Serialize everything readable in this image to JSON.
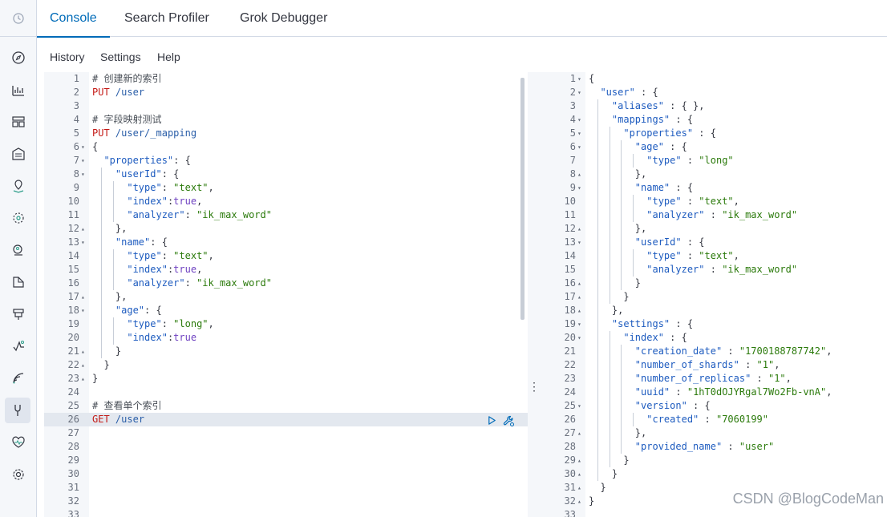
{
  "tabs": [
    {
      "label": "Console",
      "active": true
    },
    {
      "label": "Search Profiler",
      "active": false
    },
    {
      "label": "Grok Debugger",
      "active": false
    }
  ],
  "menu": {
    "history": "History",
    "settings": "Settings",
    "help": "Help"
  },
  "sidenav": [
    {
      "icon": "clock-icon"
    },
    {
      "icon": "compass-icon"
    },
    {
      "icon": "chart-icon"
    },
    {
      "icon": "dashboard-icon"
    },
    {
      "icon": "canvas-icon"
    },
    {
      "icon": "maps-icon"
    },
    {
      "icon": "ml-icon"
    },
    {
      "icon": "graph-icon"
    },
    {
      "icon": "logs-icon"
    },
    {
      "icon": "apm-icon"
    },
    {
      "icon": "uptime-icon"
    },
    {
      "icon": "signal-icon"
    },
    {
      "icon": "devtools-icon",
      "active": true
    },
    {
      "icon": "heart-monitor-icon"
    },
    {
      "icon": "gear-icon"
    }
  ],
  "request_lines": [
    {
      "n": "1",
      "fold": "",
      "code": "# 创建新的索引",
      "type": "comment"
    },
    {
      "n": "2",
      "fold": "",
      "code": "PUT /user",
      "type": "request"
    },
    {
      "n": "3",
      "fold": "",
      "code": "",
      "type": "plain"
    },
    {
      "n": "4",
      "fold": "",
      "code": "# 字段映射测试",
      "type": "comment"
    },
    {
      "n": "5",
      "fold": "",
      "code": "PUT /user/_mapping",
      "type": "request"
    },
    {
      "n": "6",
      "fold": "▾",
      "code": "{",
      "type": "plain"
    },
    {
      "n": "7",
      "fold": "▾",
      "code": "  \"properties\": {",
      "type": "json"
    },
    {
      "n": "8",
      "fold": "▾",
      "code": "    \"userId\": {",
      "type": "json"
    },
    {
      "n": "9",
      "fold": "",
      "code": "      \"type\": \"text\",",
      "type": "json"
    },
    {
      "n": "10",
      "fold": "",
      "code": "      \"index\":true,",
      "type": "json"
    },
    {
      "n": "11",
      "fold": "",
      "code": "      \"analyzer\": \"ik_max_word\"",
      "type": "json"
    },
    {
      "n": "12",
      "fold": "▴",
      "code": "    },",
      "type": "json"
    },
    {
      "n": "13",
      "fold": "▾",
      "code": "    \"name\": {",
      "type": "json"
    },
    {
      "n": "14",
      "fold": "",
      "code": "      \"type\": \"text\",",
      "type": "json"
    },
    {
      "n": "15",
      "fold": "",
      "code": "      \"index\":true,",
      "type": "json"
    },
    {
      "n": "16",
      "fold": "",
      "code": "      \"analyzer\": \"ik_max_word\"",
      "type": "json"
    },
    {
      "n": "17",
      "fold": "▴",
      "code": "    },",
      "type": "json"
    },
    {
      "n": "18",
      "fold": "▾",
      "code": "    \"age\": {",
      "type": "json"
    },
    {
      "n": "19",
      "fold": "",
      "code": "      \"type\": \"long\",",
      "type": "json"
    },
    {
      "n": "20",
      "fold": "",
      "code": "      \"index\":true",
      "type": "json"
    },
    {
      "n": "21",
      "fold": "▴",
      "code": "    }",
      "type": "json"
    },
    {
      "n": "22",
      "fold": "▴",
      "code": "  }",
      "type": "json"
    },
    {
      "n": "23",
      "fold": "▴",
      "code": "}",
      "type": "plain"
    },
    {
      "n": "24",
      "fold": "",
      "code": "",
      "type": "plain"
    },
    {
      "n": "25",
      "fold": "",
      "code": "# 查看单个索引",
      "type": "comment"
    },
    {
      "n": "26",
      "fold": "",
      "code": "GET /user",
      "type": "request",
      "active": true
    },
    {
      "n": "27",
      "fold": "",
      "code": "",
      "type": "plain"
    },
    {
      "n": "28",
      "fold": "",
      "code": "",
      "type": "plain"
    },
    {
      "n": "29",
      "fold": "",
      "code": "",
      "type": "plain"
    },
    {
      "n": "30",
      "fold": "",
      "code": "",
      "type": "plain"
    },
    {
      "n": "31",
      "fold": "",
      "code": "",
      "type": "plain"
    },
    {
      "n": "32",
      "fold": "",
      "code": "",
      "type": "plain"
    },
    {
      "n": "33",
      "fold": "",
      "code": "",
      "type": "plain"
    }
  ],
  "response_lines": [
    {
      "n": "1",
      "fold": "▾",
      "code": "{",
      "type": "plain"
    },
    {
      "n": "2",
      "fold": "▾",
      "code": "  \"user\" : {",
      "type": "json"
    },
    {
      "n": "3",
      "fold": "",
      "code": "    \"aliases\" : { },",
      "type": "json"
    },
    {
      "n": "4",
      "fold": "▾",
      "code": "    \"mappings\" : {",
      "type": "json"
    },
    {
      "n": "5",
      "fold": "▾",
      "code": "      \"properties\" : {",
      "type": "json"
    },
    {
      "n": "6",
      "fold": "▾",
      "code": "        \"age\" : {",
      "type": "json"
    },
    {
      "n": "7",
      "fold": "",
      "code": "          \"type\" : \"long\"",
      "type": "json"
    },
    {
      "n": "8",
      "fold": "▴",
      "code": "        },",
      "type": "json"
    },
    {
      "n": "9",
      "fold": "▾",
      "code": "        \"name\" : {",
      "type": "json"
    },
    {
      "n": "10",
      "fold": "",
      "code": "          \"type\" : \"text\",",
      "type": "json"
    },
    {
      "n": "11",
      "fold": "",
      "code": "          \"analyzer\" : \"ik_max_word\"",
      "type": "json"
    },
    {
      "n": "12",
      "fold": "▴",
      "code": "        },",
      "type": "json"
    },
    {
      "n": "13",
      "fold": "▾",
      "code": "        \"userId\" : {",
      "type": "json"
    },
    {
      "n": "14",
      "fold": "",
      "code": "          \"type\" : \"text\",",
      "type": "json"
    },
    {
      "n": "15",
      "fold": "",
      "code": "          \"analyzer\" : \"ik_max_word\"",
      "type": "json"
    },
    {
      "n": "16",
      "fold": "▴",
      "code": "        }",
      "type": "json"
    },
    {
      "n": "17",
      "fold": "▴",
      "code": "      }",
      "type": "json"
    },
    {
      "n": "18",
      "fold": "▴",
      "code": "    },",
      "type": "json"
    },
    {
      "n": "19",
      "fold": "▾",
      "code": "    \"settings\" : {",
      "type": "json"
    },
    {
      "n": "20",
      "fold": "▾",
      "code": "      \"index\" : {",
      "type": "json"
    },
    {
      "n": "21",
      "fold": "",
      "code": "        \"creation_date\" : \"1700188787742\",",
      "type": "json"
    },
    {
      "n": "22",
      "fold": "",
      "code": "        \"number_of_shards\" : \"1\",",
      "type": "json"
    },
    {
      "n": "23",
      "fold": "",
      "code": "        \"number_of_replicas\" : \"1\",",
      "type": "json"
    },
    {
      "n": "24",
      "fold": "",
      "code": "        \"uuid\" : \"1hT0dOJYRgal7Wo2Fb-vnA\",",
      "type": "json"
    },
    {
      "n": "25",
      "fold": "▾",
      "code": "        \"version\" : {",
      "type": "json"
    },
    {
      "n": "26",
      "fold": "",
      "code": "          \"created\" : \"7060199\"",
      "type": "json"
    },
    {
      "n": "27",
      "fold": "▴",
      "code": "        },",
      "type": "json"
    },
    {
      "n": "28",
      "fold": "",
      "code": "        \"provided_name\" : \"user\"",
      "type": "json"
    },
    {
      "n": "29",
      "fold": "▴",
      "code": "      }",
      "type": "json"
    },
    {
      "n": "30",
      "fold": "▴",
      "code": "    }",
      "type": "json"
    },
    {
      "n": "31",
      "fold": "▴",
      "code": "  }",
      "type": "json"
    },
    {
      "n": "32",
      "fold": "▴",
      "code": "}",
      "type": "plain"
    },
    {
      "n": "33",
      "fold": "",
      "code": "",
      "type": "plain"
    }
  ],
  "watermark": "CSDN @BlogCodeMan",
  "colors": {
    "accent": "#006bb8",
    "method": "#c41a16",
    "string": "#2b7a0b",
    "key": "#1d5bbf"
  }
}
